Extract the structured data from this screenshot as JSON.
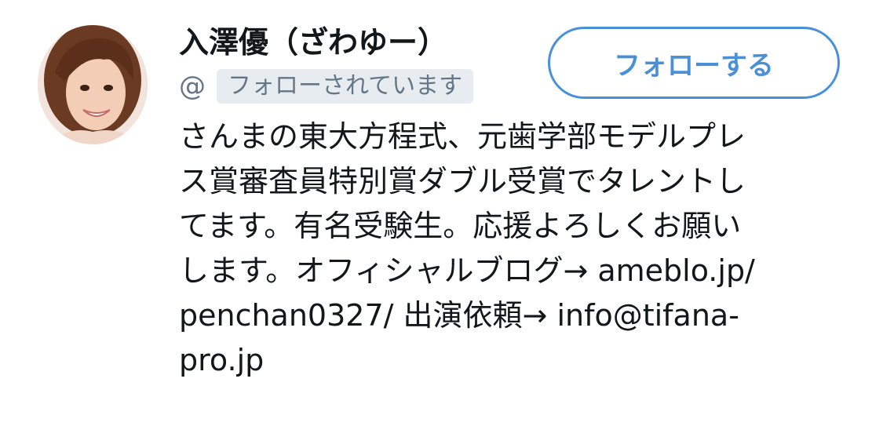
{
  "profile": {
    "name": "入澤優（ざわゆー）",
    "handle": "@",
    "follows_you": "フォローされています",
    "avatar": "profile-photo"
  },
  "actions": {
    "follow_label": "フォローする",
    "accent_color": "#4a90d9"
  },
  "bio": {
    "lines": [
      "さんまの東大方程式、元歯学部モデルプレ",
      "ス賞審査員特別賞ダブル受賞でタレントし",
      "てます。有名受験生。応援よろしくお願い",
      "します。オフィシャルブログ→ ameblo.jp/",
      "penchan0327/ 出演依頼→ info@tifana-",
      "pro.jp"
    ]
  }
}
